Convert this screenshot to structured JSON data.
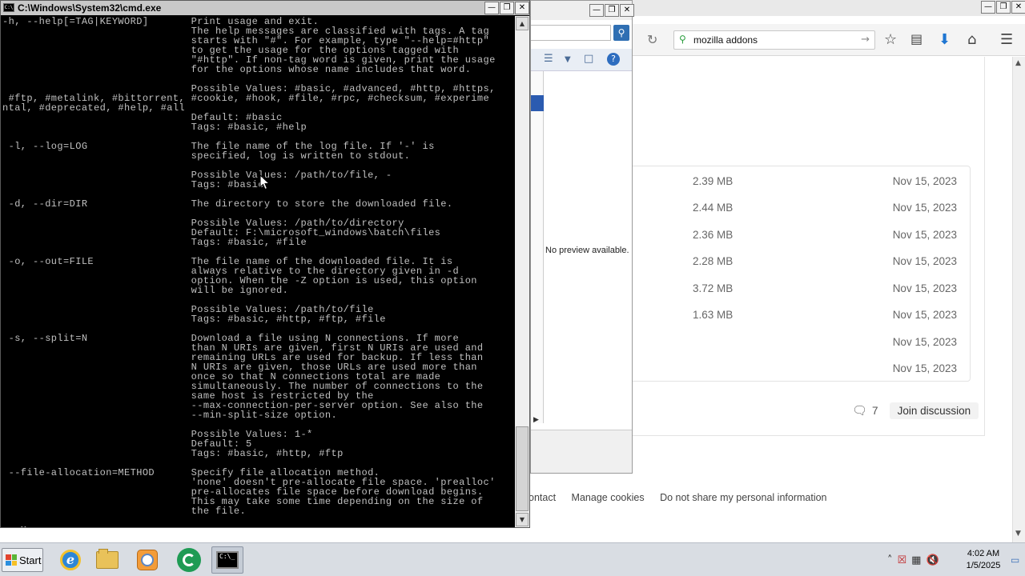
{
  "browser": {
    "url_text": "mozilla addons",
    "files": [
      {
        "size": "2.39 MB",
        "date": "Nov 15, 2023"
      },
      {
        "size": "2.44 MB",
        "date": "Nov 15, 2023"
      },
      {
        "size": "2.36 MB",
        "date": "Nov 15, 2023"
      },
      {
        "size": "2.28 MB",
        "date": "Nov 15, 2023"
      },
      {
        "size": "3.72 MB",
        "date": "Nov 15, 2023"
      },
      {
        "size": "1.63 MB",
        "date": "Nov 15, 2023"
      },
      {
        "size": "",
        "date": "Nov 15, 2023"
      },
      {
        "size": "",
        "date": "Nov 15, 2023"
      }
    ],
    "comment_count": "7",
    "join_label": "Join discussion",
    "footer_links": [
      "ontact",
      "Manage cookies",
      "Do not share my personal information"
    ]
  },
  "explorer": {
    "preview_text": "No preview available."
  },
  "cmd": {
    "title": "C:\\Windows\\System32\\cmd.exe",
    "lines": [
      "-h, --help[=TAG|KEYWORD]       Print usage and exit.",
      "                               The help messages are classified with tags. A tag",
      "                               starts with \"#\". For example, type \"--help=#http\"",
      "                               to get the usage for the options tagged with",
      "                               \"#http\". If non-tag word is given, print the usage",
      "                               for the options whose name includes that word.",
      "",
      "                               Possible Values: #basic, #advanced, #http, #https,",
      " #ftp, #metalink, #bittorrent, #cookie, #hook, #file, #rpc, #checksum, #experime",
      "ntal, #deprecated, #help, #all",
      "                               Default: #basic",
      "                               Tags: #basic, #help",
      "",
      " -l, --log=LOG                 The file name of the log file. If '-' is",
      "                               specified, log is written to stdout.",
      "",
      "                               Possible Values: /path/to/file, -",
      "                               Tags: #basic",
      "",
      " -d, --dir=DIR                 The directory to store the downloaded file.",
      "",
      "                               Possible Values: /path/to/directory",
      "                               Default: F:\\microsoft_windows\\batch\\files",
      "                               Tags: #basic, #file",
      "",
      " -o, --out=FILE                The file name of the downloaded file. It is",
      "                               always relative to the directory given in -d",
      "                               option. When the -Z option is used, this option",
      "                               will be ignored.",
      "",
      "                               Possible Values: /path/to/file",
      "                               Tags: #basic, #http, #ftp, #file",
      "",
      " -s, --split=N                 Download a file using N connections. If more",
      "                               than N URIs are given, first N URIs are used and",
      "                               remaining URLs are used for backup. If less than",
      "                               N URIs are given, those URLs are used more than",
      "                               once so that N connections total are made",
      "                               simultaneously. The number of connections to the",
      "                               same host is restricted by the",
      "                               --max-connection-per-server option. See also the",
      "                               --min-split-size option.",
      "",
      "                               Possible Values: 1-*",
      "                               Default: 5",
      "                               Tags: #basic, #http, #ftp",
      "",
      " --file-allocation=METHOD      Specify file allocation method.",
      "                               'none' doesn't pre-allocate file space. 'prealloc'",
      "                               pre-allocates file space before download begins.",
      "                               This may take some time depending on the size of",
      "                               the file.",
      "",
      "-- More  --"
    ]
  },
  "taskbar": {
    "start_label": "Start",
    "cmd_icon_text": "C:\\_",
    "time": "4:02 AM",
    "date": "1/5/2025"
  }
}
